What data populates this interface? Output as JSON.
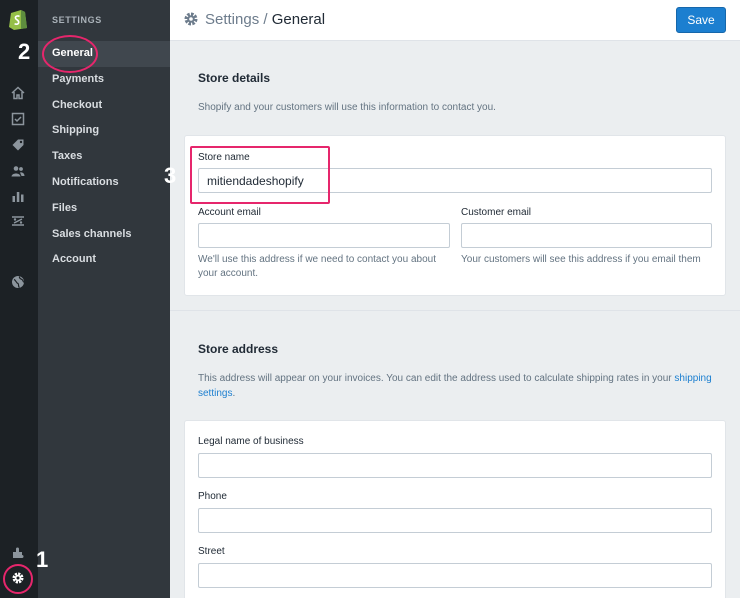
{
  "nav": {
    "heading": "SETTINGS",
    "items": [
      {
        "label": "General",
        "active": true
      },
      {
        "label": "Payments"
      },
      {
        "label": "Checkout"
      },
      {
        "label": "Shipping"
      },
      {
        "label": "Taxes"
      },
      {
        "label": "Notifications"
      },
      {
        "label": "Files"
      },
      {
        "label": "Sales channels"
      },
      {
        "label": "Account"
      }
    ]
  },
  "rail_icons": [
    "shopify-logo-icon",
    "home-icon",
    "orders-icon",
    "products-icon",
    "customers-icon",
    "reports-icon",
    "discounts-icon",
    "online-store-icon",
    "apps-icon",
    "settings-icon"
  ],
  "header": {
    "section": "Settings",
    "separator": " / ",
    "page": "General",
    "save_label": "Save"
  },
  "store_details": {
    "title": "Store details",
    "description": "Shopify and your customers will use this information to contact you.",
    "store_name": {
      "label": "Store name",
      "value": "mitiendadeshopify"
    },
    "account_email": {
      "label": "Account email",
      "value": "",
      "help": "We'll use this address if we need to contact you about your account."
    },
    "customer_email": {
      "label": "Customer email",
      "value": "",
      "help": "Your customers will see this address if you email them"
    }
  },
  "store_address": {
    "title": "Store address",
    "description": "This address will appear on your invoices. You can edit the address used to calculate shipping rates in your",
    "link": "shipping settings",
    "link_suffix": ".",
    "legal_name": {
      "label": "Legal name of business",
      "value": ""
    },
    "phone": {
      "label": "Phone",
      "value": ""
    },
    "street": {
      "label": "Street",
      "value": ""
    }
  },
  "annotations": {
    "one": "1",
    "two": "2",
    "three": "3"
  },
  "colors": {
    "accent": "#1c7fd0",
    "annotation": "#e6266c",
    "rail": "#1c2125",
    "nav": "#31373d"
  }
}
